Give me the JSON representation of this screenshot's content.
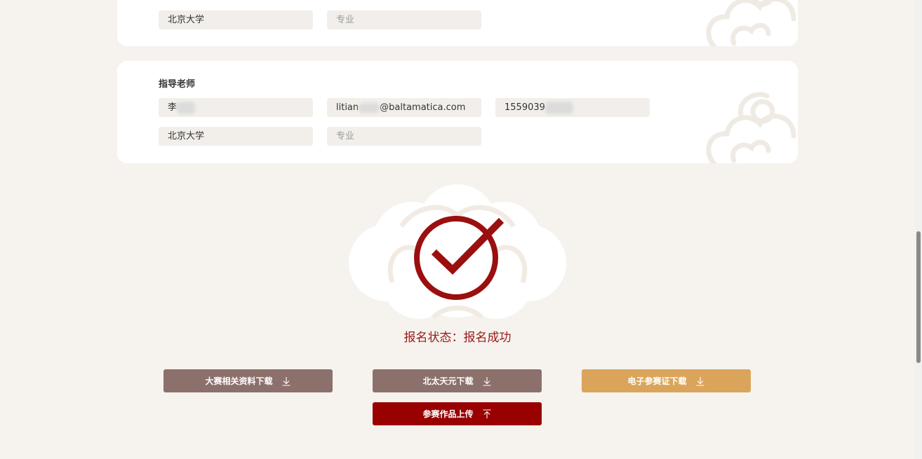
{
  "top_card": {
    "school": "北京大学",
    "major_placeholder": "专业"
  },
  "teacher_card": {
    "title": "指导老师",
    "name": "李",
    "email_prefix": "litian",
    "email_suffix": "@baltamatica.com",
    "phone": "1559039",
    "school": "北京大学",
    "major_placeholder": "专业"
  },
  "status": {
    "text": "报名状态：报名成功",
    "color": "#9b1818"
  },
  "buttons": {
    "materials_label": "大赛相关资料下载",
    "beitai_label": "北太天元下载",
    "cert_label": "电子参赛证下载",
    "upload_label": "参赛作品上传",
    "download_icon": "download-icon",
    "upload_icon": "upload-icon"
  },
  "colors": {
    "background": "#f6f3ee",
    "brown_button": "#8c706c",
    "gold_button": "#daa55a",
    "red_button": "#990000"
  }
}
